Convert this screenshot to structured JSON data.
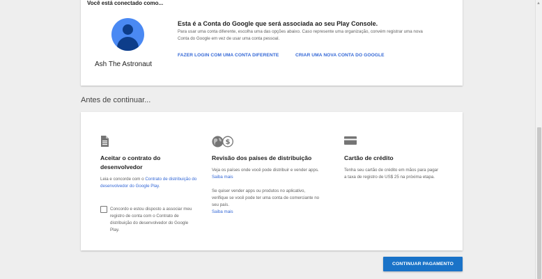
{
  "top_card": {
    "connected_title": "Você está conectado como...",
    "account_name": "Ash The Astronaut",
    "assoc_title": "Esta é a Conta do Google que será associada ao seu Play Console.",
    "assoc_desc": "Para usar uma conta diferente, escolha uma das opções abaixo. Caso represente uma organização, convém registrar uma nova Conta do Google em vez de usar uma conta pessoal.",
    "link_login": "FAZER LOGIN COM UMA CONTA DIFERENTE",
    "link_create": "CRIAR UMA NOVA CONTA DO GOOGLE"
  },
  "section_title": "Antes de continuar...",
  "columns": {
    "contract": {
      "icon": "document-icon",
      "title": "Aceitar o contrato do desenvolvedor",
      "text_prefix": "Leia e concorde com o ",
      "text_link": "Contrato de distribuição do desenvolvedor do Google Play",
      "text_suffix": ".",
      "agree_label": "Concordo e estou disposto a associar meu registro de conta com o Contrato de distribuição do desenvolvedor do Google Play.",
      "agree_checked": false
    },
    "countries": {
      "icon": "globe-dollar-icon",
      "title": "Revisão dos países de distribuição",
      "text1": "Veja os países onde você pode distribuir e vender apps.",
      "text1_link": "Saiba mais",
      "text2": "Se quiser vender apps ou produtos no aplicativo, verifique se você pode ter uma conta de comerciante no seu país.",
      "text2_link": "Saiba mais"
    },
    "credit": {
      "icon": "credit-card-icon",
      "title": "Cartão de crédito",
      "text": "Tenha seu cartão de crédito em mãos para pagar a taxa de registro de US$ 25 na próxima etapa."
    }
  },
  "continue_button": "CONTINUAR PAGAMENTO",
  "colors": {
    "accent": "#3367d6",
    "primary_button": "#1a73c8",
    "avatar": "#4a89f3"
  }
}
